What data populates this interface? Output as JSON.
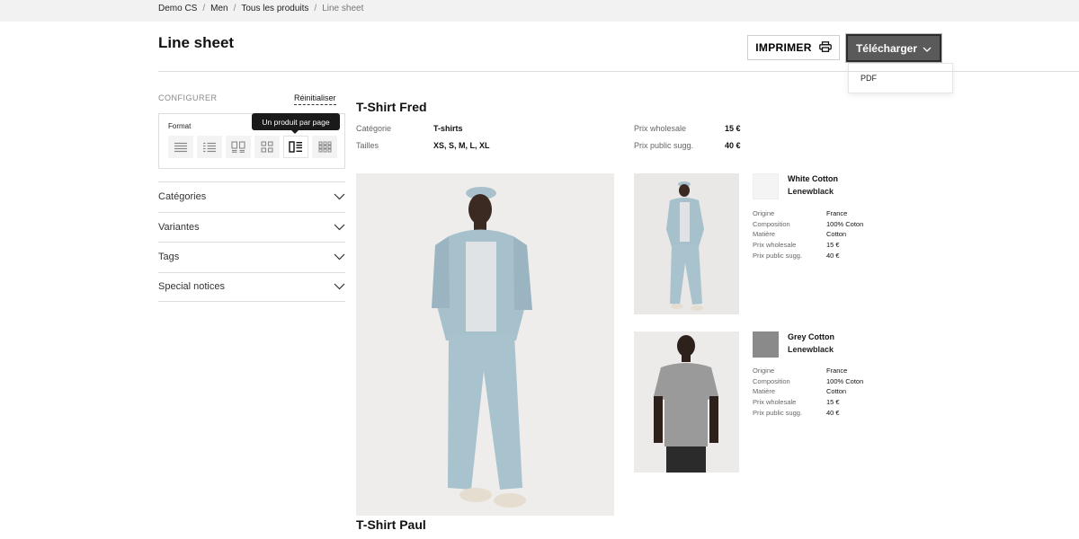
{
  "breadcrumb": {
    "items": [
      "Demo CS",
      "Men",
      "Tous les produits"
    ],
    "current": "Line sheet",
    "separator": "/"
  },
  "header": {
    "title": "Line sheet",
    "print_label": "IMPRIMER",
    "download_label": "Télécharger",
    "download_options": [
      "PDF"
    ]
  },
  "config": {
    "label": "CONFIGURER",
    "reset_label": "Réinitialiser",
    "format_label": "Format",
    "tooltip": "Un produit par page",
    "formats": [
      "list-icon",
      "detailed-list-icon",
      "two-column-icon",
      "grid-four-icon",
      "one-per-page-icon",
      "grid-six-icon"
    ],
    "active_format": 4,
    "filters": [
      "Catégories",
      "Variantes",
      "Tags",
      "Special notices"
    ]
  },
  "product": {
    "name": "T-Shirt Fred",
    "category_label": "Catégorie",
    "category": "T-shirts",
    "sizes_label": "Tailles",
    "sizes": "XS, S, M, L, XL",
    "wholesale_label": "Prix wholesale",
    "wholesale": "15 €",
    "retail_label": "Prix public sugg.",
    "retail": "40 €",
    "variants": [
      {
        "name": "White Cotton",
        "brand": "Lenewblack",
        "swatch": "#f4f4f4",
        "specs": [
          [
            "Origine",
            "France"
          ],
          [
            "Composition",
            "100% Coton"
          ],
          [
            "Matière",
            "Cotton"
          ],
          [
            "Prix wholesale",
            "15 €"
          ],
          [
            "Prix public sugg.",
            "40 €"
          ]
        ]
      },
      {
        "name": "Grey Cotton",
        "brand": "Lenewblack",
        "swatch": "#8a8a8a",
        "specs": [
          [
            "Origine",
            "France"
          ],
          [
            "Composition",
            "100% Coton"
          ],
          [
            "Matière",
            "Cotton"
          ],
          [
            "Prix wholesale",
            "15 €"
          ],
          [
            "Prix public sugg.",
            "40 €"
          ]
        ]
      }
    ]
  },
  "next_product": {
    "name": "T-Shirt Paul"
  }
}
